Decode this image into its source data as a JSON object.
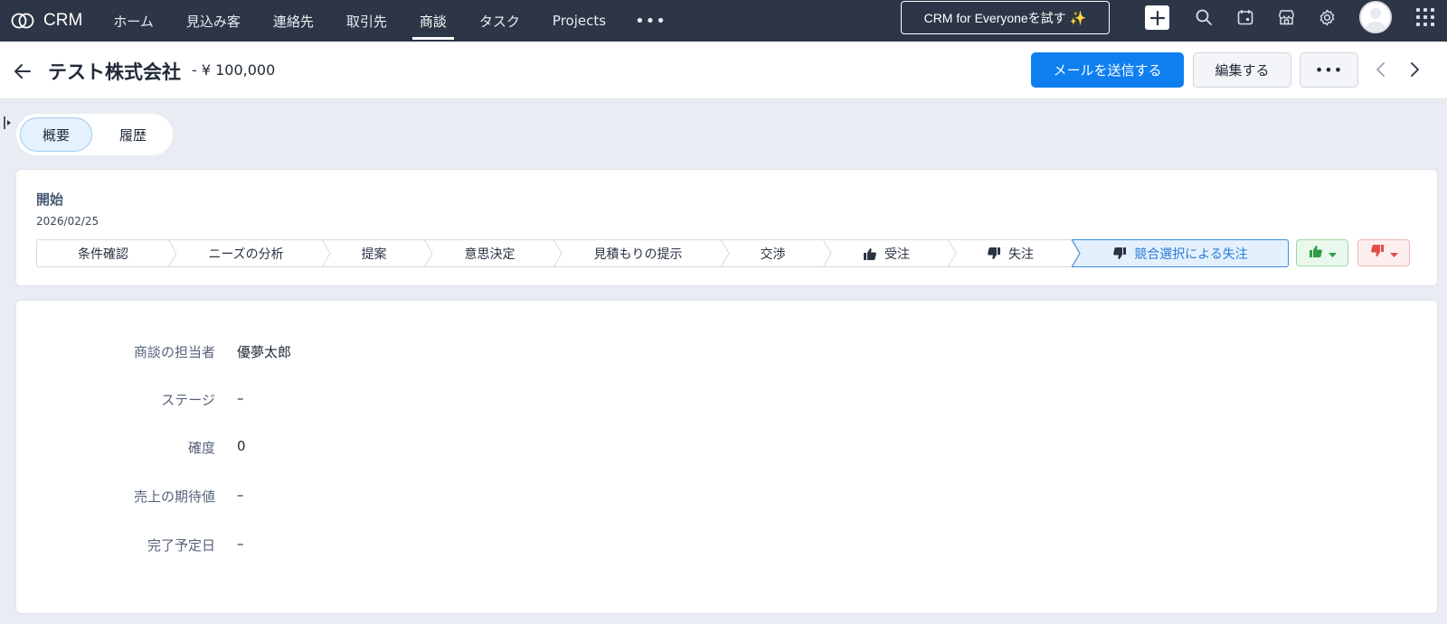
{
  "topnav": {
    "brand": "CRM",
    "items": [
      {
        "label": "ホーム"
      },
      {
        "label": "見込み客"
      },
      {
        "label": "連絡先"
      },
      {
        "label": "取引先"
      },
      {
        "label": "商談"
      },
      {
        "label": "タスク"
      },
      {
        "label": "Projects"
      }
    ],
    "active_index": 4,
    "more": "•••",
    "try_button": "CRM for Everyoneを試す",
    "icons": [
      "plus-icon",
      "search-icon",
      "calendar-icon",
      "marketplace-icon",
      "settings-icon",
      "avatar",
      "apps-grid-icon"
    ]
  },
  "header": {
    "title": "テスト株式会社",
    "amount": "- ¥ 100,000",
    "send_email": "メールを送信する",
    "edit": "編集する",
    "more": "•••"
  },
  "tabs": {
    "overview": "概要",
    "history": "履歴"
  },
  "stage_card": {
    "start_label": "開始",
    "start_date": "2026/02/25",
    "stages": [
      {
        "label": "条件確認"
      },
      {
        "label": "ニーズの分析"
      },
      {
        "label": "提案"
      },
      {
        "label": "意思決定"
      },
      {
        "label": "見積もりの提示"
      },
      {
        "label": "交渉"
      },
      {
        "label": "受注",
        "icon": "thumbs-up-icon"
      },
      {
        "label": "失注",
        "icon": "thumbs-down-icon"
      },
      {
        "label": "競合選択による失注",
        "icon": "thumbs-down-icon"
      }
    ],
    "current_index": 8,
    "colors": {
      "won": "#2e9e44",
      "lost": "#e34b4b",
      "current": "#2a7ad8"
    }
  },
  "details": {
    "fields": [
      {
        "label": "商談の担当者",
        "value": "優夢太郎"
      },
      {
        "label": "ステージ",
        "value": "–"
      },
      {
        "label": "確度",
        "value": "0"
      },
      {
        "label": "売上の期待値",
        "value": "–"
      },
      {
        "label": "完了予定日",
        "value": "–"
      }
    ]
  }
}
